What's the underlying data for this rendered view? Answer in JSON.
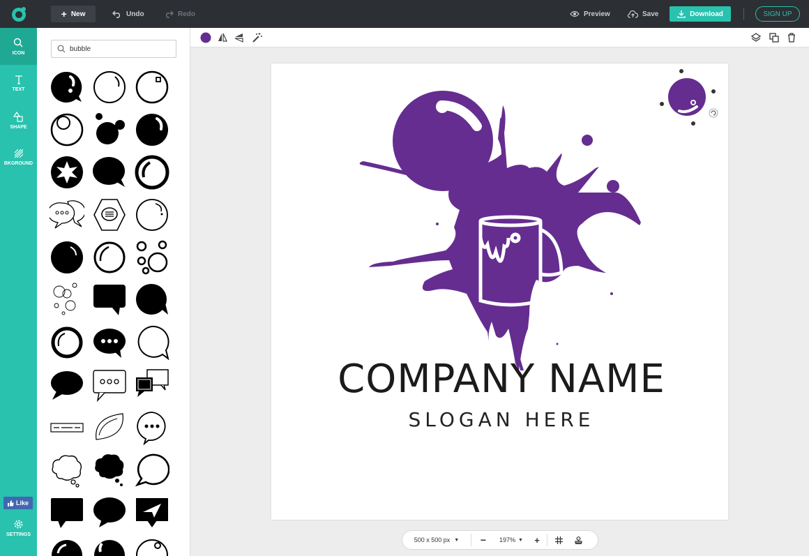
{
  "topbar": {
    "new_label": "New",
    "undo_label": "Undo",
    "redo_label": "Redo",
    "preview_label": "Preview",
    "save_label": "Save",
    "download_label": "Download",
    "signup_label": "SIGN UP"
  },
  "rail": {
    "items": [
      {
        "label": "ICON"
      },
      {
        "label": "TEXT"
      },
      {
        "label": "SHAPE"
      },
      {
        "label": "BKGROUND"
      }
    ],
    "like_label": "Like",
    "settings_label": "SETTINGS"
  },
  "search": {
    "value": "bubble"
  },
  "canvas": {
    "company_name": "COMPANY NAME",
    "slogan": "SLOGAN HERE",
    "accent_color": "#652d90"
  },
  "bottom": {
    "size_label": "500 x 500 px",
    "zoom_label": "197%"
  },
  "colors": {
    "teal": "#28c2ae",
    "dark": "#2c2f33",
    "purple": "#652d90"
  }
}
